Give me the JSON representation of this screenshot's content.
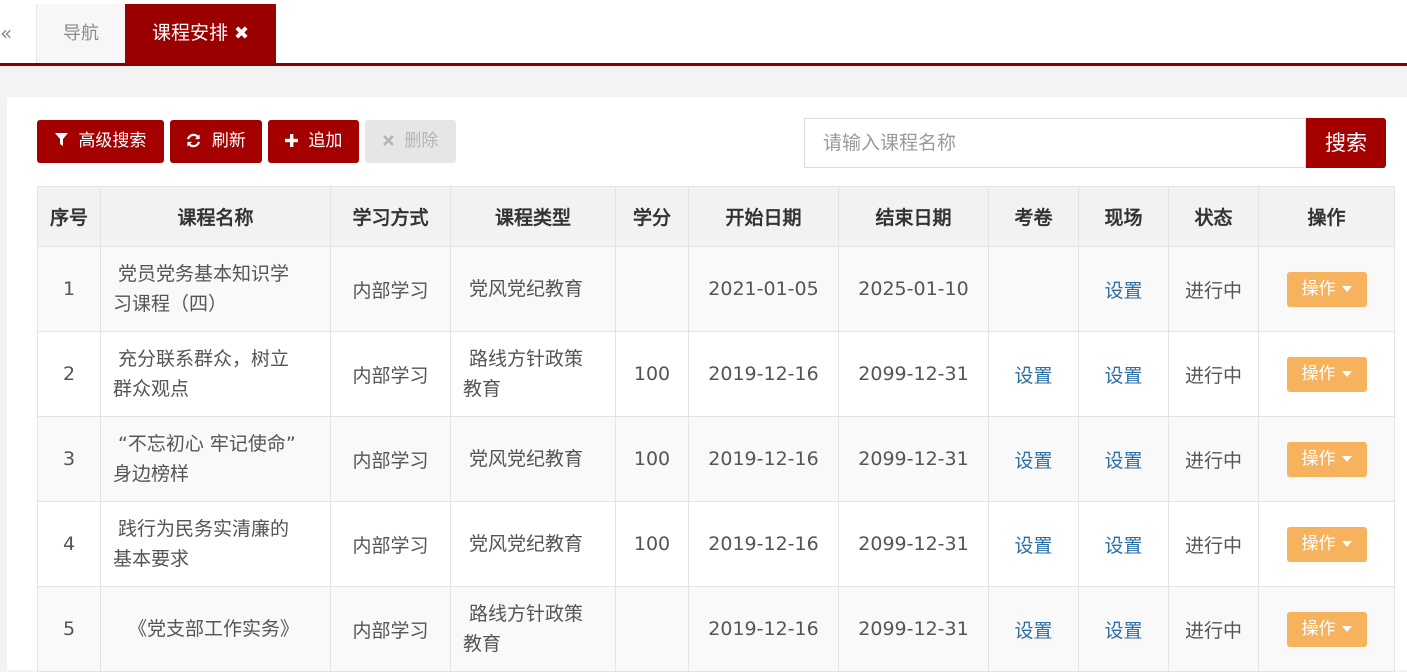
{
  "tabs": {
    "collapse_label": "«",
    "nav_label": "导航",
    "active_label": "课程安排",
    "active_close": "✖"
  },
  "toolbar": {
    "advanced_search_label": "高级搜索",
    "refresh_label": "刷新",
    "add_label": "追加",
    "delete_label": "删除"
  },
  "search": {
    "placeholder": "请输入课程名称",
    "button_label": "搜索"
  },
  "table": {
    "columns": [
      "序号",
      "课程名称",
      "学习方式",
      "课程类型",
      "学分",
      "开始日期",
      "结束日期",
      "考卷",
      "现场",
      "状态",
      "操作"
    ],
    "rows": [
      {
        "no": "1",
        "name_line1": "党员党务基本知识学",
        "name_line2": "习课程（四）",
        "mode": "内部学习",
        "type_line1": "党风党纪教育",
        "type_line2": "",
        "credit": "",
        "start": "2021-01-05",
        "end": "2025-01-10",
        "exam": "",
        "site": "设置",
        "status": "进行中",
        "op": "操作"
      },
      {
        "no": "2",
        "name_line1": "充分联系群众，树立",
        "name_line2": "群众观点",
        "mode": "内部学习",
        "type_line1": "路线方针政策",
        "type_line2": "教育",
        "credit": "100",
        "start": "2019-12-16",
        "end": "2099-12-31",
        "exam": "设置",
        "site": "设置",
        "status": "进行中",
        "op": "操作"
      },
      {
        "no": "3",
        "name_line1": "“不忘初心 牢记使命”",
        "name_line2": "身边榜样",
        "mode": "内部学习",
        "type_line1": "党风党纪教育",
        "type_line2": "",
        "credit": "100",
        "start": "2019-12-16",
        "end": "2099-12-31",
        "exam": "设置",
        "site": "设置",
        "status": "进行中",
        "op": "操作"
      },
      {
        "no": "4",
        "name_line1": "践行为民务实清廉的",
        "name_line2": "基本要求",
        "mode": "内部学习",
        "type_line1": "党风党纪教育",
        "type_line2": "",
        "credit": "100",
        "start": "2019-12-16",
        "end": "2099-12-31",
        "exam": "设置",
        "site": "设置",
        "status": "进行中",
        "op": "操作"
      },
      {
        "no": "5",
        "name_line1": "《党支部工作实务》",
        "name_line2": "",
        "mode": "内部学习",
        "type_line1": "路线方针政策",
        "type_line2": "教育",
        "credit": "",
        "start": "2019-12-16",
        "end": "2099-12-31",
        "exam": "设置",
        "site": "设置",
        "status": "进行中",
        "op": "操作"
      }
    ]
  },
  "colors": {
    "brand": "#9b0000",
    "link": "#2a6ea5",
    "op_button": "#f6b25c"
  }
}
